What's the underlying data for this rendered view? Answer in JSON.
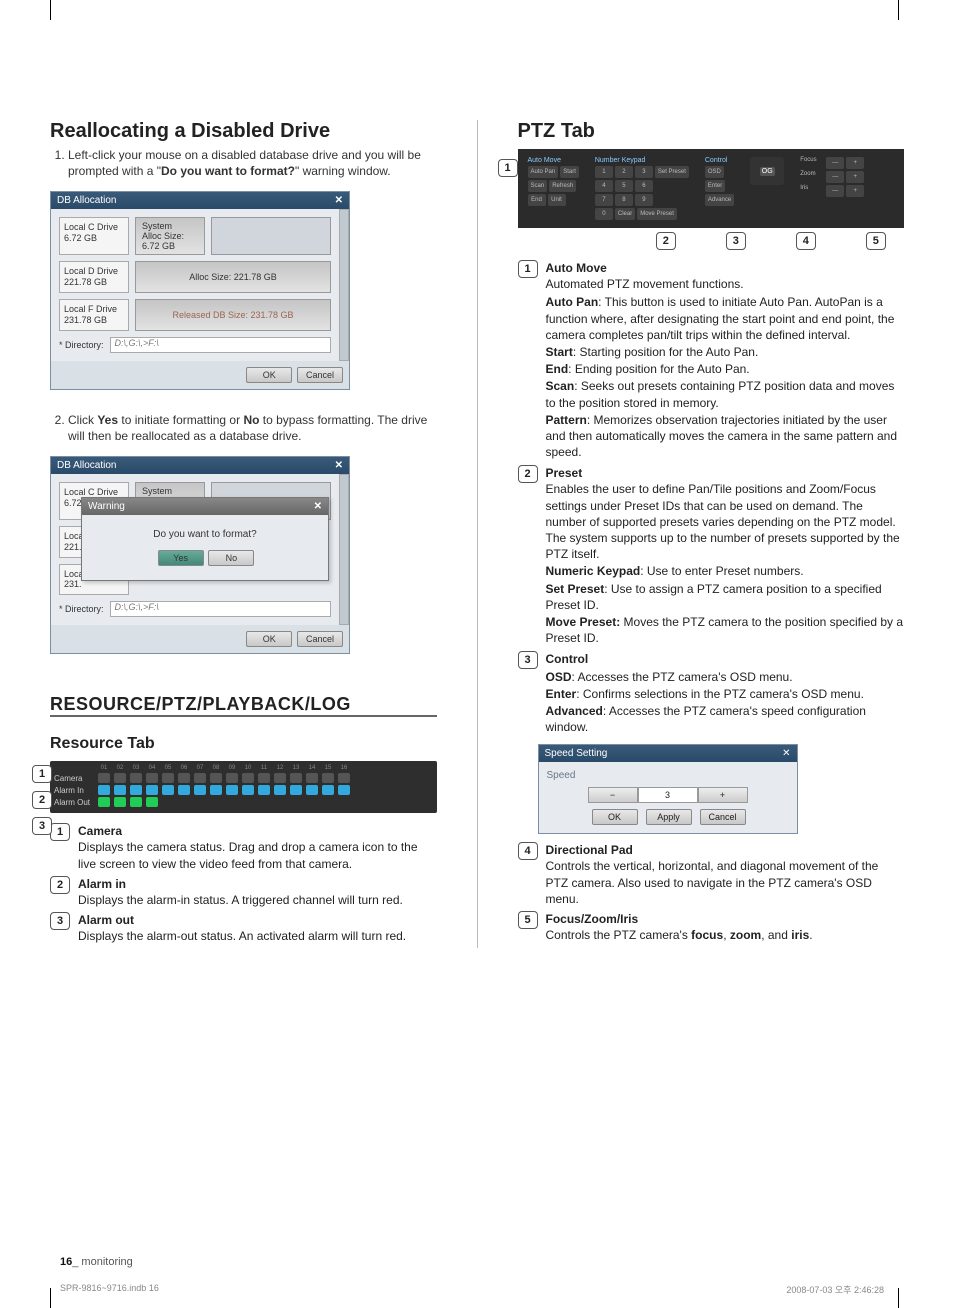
{
  "left": {
    "realloc_heading": "Reallocating a Disabled Drive",
    "step1": "Left-click your mouse on a disabled database drive and you will be prompted with a \"",
    "step1_bold": "Do you want to format?",
    "step1_tail": "\" warning window.",
    "step2_a": "Click ",
    "step2_yes": "Yes",
    "step2_b": " to initiate formatting or ",
    "step2_no": "No",
    "step2_c": " to bypass formatting. The drive will then be reallocated as a database drive.",
    "dlg": {
      "title": "DB Allocation",
      "close": "✕",
      "driveC_label": "Local C Drive\n6.72 GB",
      "driveC_sys": "System\nAlloc Size:\n6.72 GB",
      "driveD_label": "Local D Drive\n221.78 GB",
      "driveD_bar": "Alloc Size: 221.78 GB",
      "driveF_label": "Local F Drive\n231.78 GB",
      "driveF_bar": "Released DB Size: 231.78 GB",
      "directory_label": "*   Directory:",
      "directory_value": "D:\\,G:\\,>F:\\",
      "ok": "OK",
      "cancel": "Cancel"
    },
    "warn": {
      "title": "Warning",
      "text": "Do you want to format?",
      "yes": "Yes",
      "no": "No"
    },
    "resource_section": "RESOURCE/PTZ/PLAYBACK/LOG",
    "resource_tab": "Resource Tab",
    "rows": {
      "camera": "Camera",
      "alarmin": "Alarm In",
      "alarmout": "Alarm Out"
    },
    "res_defs": {
      "camera_title": "Camera",
      "camera_text": "Displays the camera status. Drag and drop a camera icon to the live screen to view the video feed from that camera.",
      "alarmin_title": "Alarm in",
      "alarmin_text": "Displays the alarm-in status. A triggered channel will turn red.",
      "alarmout_title": "Alarm out",
      "alarmout_text": "Displays the alarm-out status.  An activated alarm will turn red."
    }
  },
  "right": {
    "heading": "PTZ Tab",
    "groups": {
      "automove": "Auto Move",
      "autopan": "Auto Pan",
      "scan": "Scan",
      "refresh": "Refresh",
      "start": "Start",
      "end": "End",
      "unit": "Unit",
      "preset": "Number Keypad",
      "setpreset": "Set Preset",
      "clear": "Clear",
      "movepreset": "Move Preset",
      "control": "Control",
      "osd": "OSD",
      "enter": "Enter",
      "advance": "Advance",
      "og": "OG",
      "focus": "Focus",
      "zoom": "Zoom",
      "iris": "Iris",
      "minus": "—",
      "plus": "+"
    },
    "defs": {
      "automove_t": "Auto Move",
      "automove_d": "Automated PTZ movement functions.",
      "autopan_l": "Auto Pan",
      "autopan_d": ": This button is used to initiate Auto Pan. AutoPan is a function where, after designating the start point and end point, the camera completes pan/tilt trips within the defined interval.",
      "start_l": "Start",
      "start_d": ": Starting position for the Auto Pan.",
      "end_l": "End",
      "end_d": ": Ending position for the Auto Pan.",
      "scan_l": "Scan",
      "scan_d": ": Seeks out presets containing PTZ position data and moves to the position stored in memory.",
      "pattern_l": "Pattern",
      "pattern_d": ": Memorizes observation trajectories initiated by the user and then automatically moves the camera in the same pattern and speed.",
      "preset_t": "Preset",
      "preset_d": "Enables the user to define Pan/Tile positions and Zoom/Focus settings under Preset IDs that can be  used on demand. The number of supported presets varies depending on the PTZ model. The system supports up to the number of presets supported by the PTZ itself.",
      "nk_l": "Numeric Keypad",
      "nk_d": ": Use to enter Preset numbers.",
      "sp_l": "Set Preset",
      "sp_d": ": Use to assign a PTZ camera position to a specified Preset ID.",
      "mp_l": "Move Preset:",
      "mp_d": " Moves the PTZ camera to the position specified by a Preset ID.",
      "control_t": "Control",
      "osd_l": "OSD",
      "osd_d": ": Accesses the PTZ camera's OSD menu.",
      "enter_l": "Enter",
      "enter_d": ": Confirms selections in the PTZ camera's OSD menu.",
      "adv_l": "Advanced",
      "adv_d": ": Accesses the PTZ camera's speed configuration window.",
      "speed_title": "Speed Setting",
      "speed_label": "Speed",
      "speed_val": "3",
      "speed_ok": "OK",
      "speed_apply": "Apply",
      "speed_cancel": "Cancel",
      "dpad_t": "Directional Pad",
      "dpad_d": "Controls the vertical, horizontal, and diagonal movement of the PTZ camera. Also used to navigate in the PTZ camera's OSD menu.",
      "fzi_t": "Focus/Zoom/Iris",
      "fzi_a": "Controls the PTZ camera's ",
      "fzi_focus": "focus",
      "fzi_sep1": ", ",
      "fzi_zoom": "zoom",
      "fzi_sep2": ", and ",
      "fzi_iris": "iris",
      "fzi_tail": "."
    }
  },
  "footer": {
    "page_num": "16",
    "page_label": "_ monitoring",
    "file": "SPR-9816~9716.indb   16",
    "stamp": "2008-07-03   오후 2:46:28"
  }
}
